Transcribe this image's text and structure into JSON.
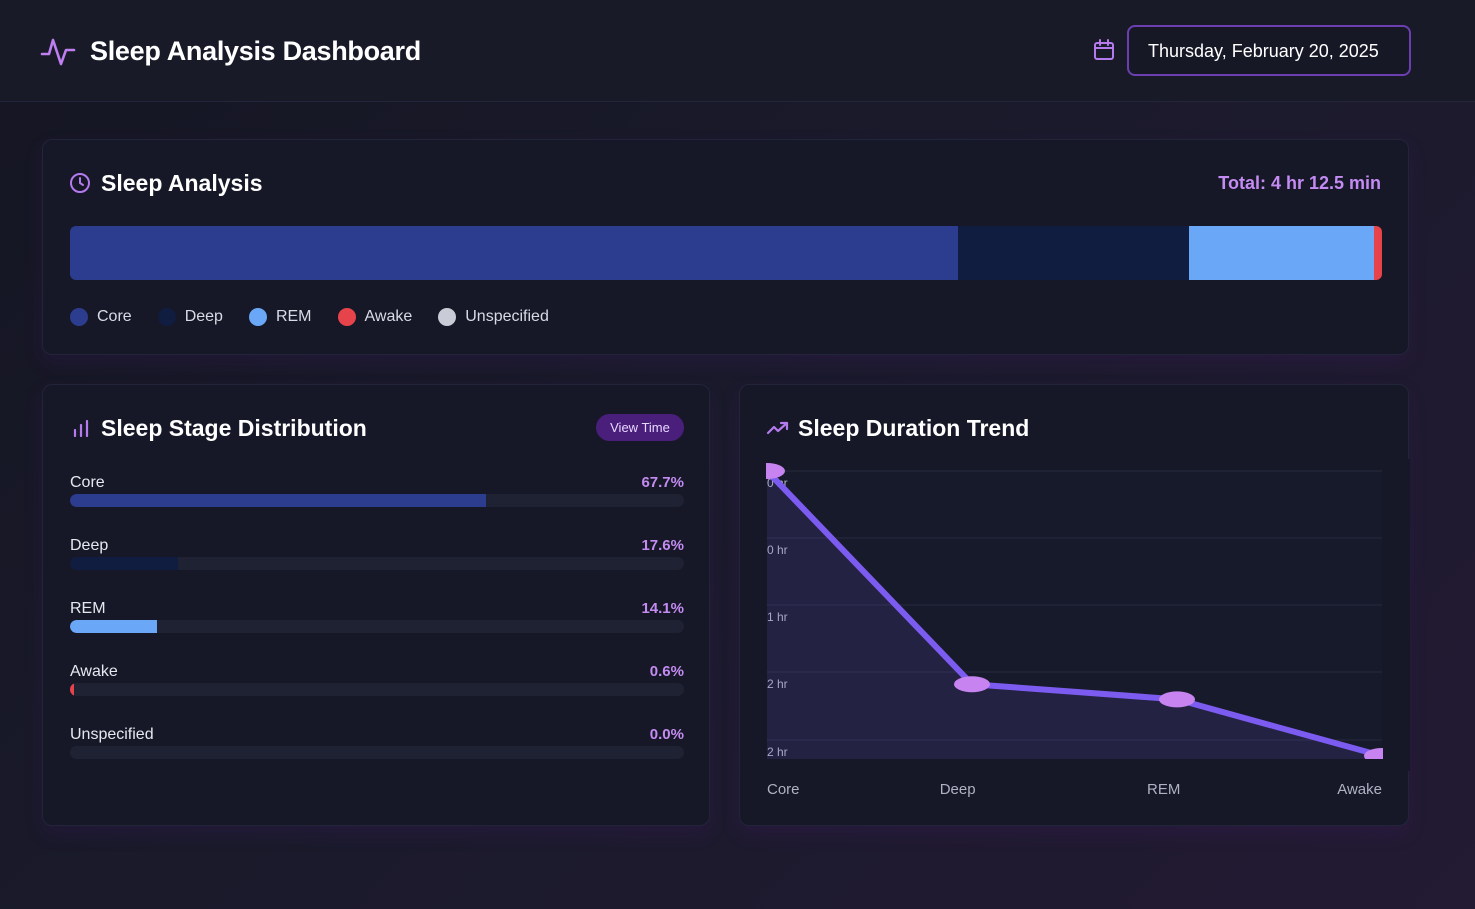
{
  "header": {
    "title": "Sleep Analysis Dashboard",
    "date": "Thursday, February 20, 2025",
    "logo_icon": "activity-pulse-icon",
    "calendar_icon": "calendar-icon"
  },
  "analysis": {
    "title": "Sleep Analysis",
    "total": "Total: 4 hr 12.5 min",
    "segments": [
      {
        "name": "Core",
        "percent": 67.7,
        "color": "#2c3c8f"
      },
      {
        "name": "Deep",
        "percent": 17.6,
        "color": "#101c40"
      },
      {
        "name": "REM",
        "percent": 14.1,
        "color": "#6aa7f7"
      },
      {
        "name": "Awake",
        "percent": 0.6,
        "color": "#e6434b"
      },
      {
        "name": "Unspecified",
        "percent": 0.0,
        "color": "#c9ccd6"
      }
    ],
    "legend": [
      {
        "label": "Core",
        "color": "#2c3c8f"
      },
      {
        "label": "Deep",
        "color": "#101c40"
      },
      {
        "label": "REM",
        "color": "#6aa7f7"
      },
      {
        "label": "Awake",
        "color": "#e6434b"
      },
      {
        "label": "Unspecified",
        "color": "#c9ccd6"
      }
    ]
  },
  "distribution": {
    "title": "Sleep Stage Distribution",
    "view_button": "View Time",
    "stages": [
      {
        "label": "Core",
        "pct": "67.7%",
        "value": 67.7,
        "color": "#2c3c8f"
      },
      {
        "label": "Deep",
        "pct": "17.6%",
        "value": 17.6,
        "color": "#101c40"
      },
      {
        "label": "REM",
        "pct": "14.1%",
        "value": 14.1,
        "color": "#6aa7f7"
      },
      {
        "label": "Awake",
        "pct": "0.6%",
        "value": 0.6,
        "color": "#e6434b"
      },
      {
        "label": "Unspecified",
        "pct": "0.0%",
        "value": 0.0,
        "color": "#c9ccd6"
      }
    ]
  },
  "trend": {
    "title": "Sleep Duration Trend",
    "line_color": "#7c5cf0",
    "point_color": "#c784f0",
    "chart_data": {
      "type": "line",
      "categories": [
        "Core",
        "Deep",
        "REM",
        "Awake"
      ],
      "y_ticks": [
        "0 hr",
        "0 hr",
        "1 hr",
        "2 hr",
        "2 hr"
      ],
      "values": [
        2.85,
        0.74,
        0.59,
        0.03
      ],
      "ylim": [
        0,
        2.85
      ],
      "grid": true
    }
  }
}
